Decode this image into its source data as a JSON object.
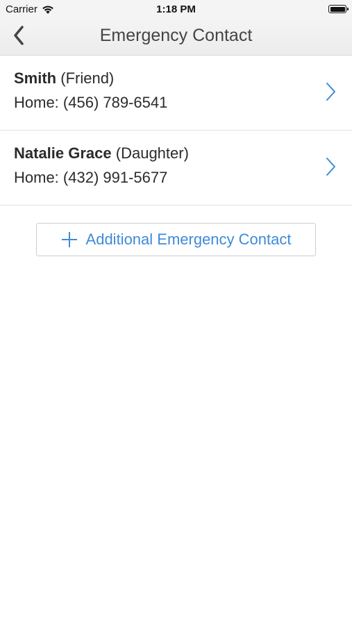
{
  "status_bar": {
    "carrier": "Carrier",
    "time": "1:18 PM",
    "icons": [
      "wifi-icon",
      "battery-icon"
    ]
  },
  "nav": {
    "title": "Emergency Contact",
    "back_icon": "chevron-left-icon"
  },
  "contacts": [
    {
      "name": "Smith",
      "relation": "(Friend)",
      "phone": "Home: (456) 789-6541"
    },
    {
      "name": "Natalie Grace",
      "relation": "(Daughter)",
      "phone": "Home: (432) 991-5677"
    }
  ],
  "add_button": {
    "label": "Additional Emergency Contact",
    "icon": "plus-icon"
  },
  "colors": {
    "accent": "#3f8ad8",
    "text": "#2b2b2b",
    "nav_background": "#f2f2f2",
    "divider": "#e2e2e2"
  }
}
